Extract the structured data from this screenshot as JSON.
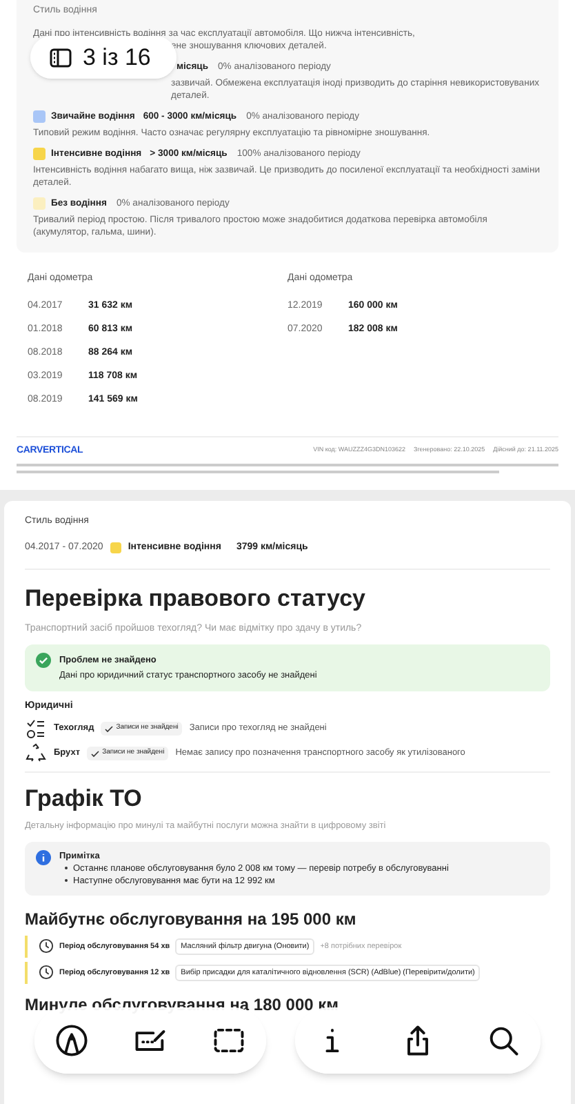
{
  "page_indicator": {
    "text": "3 із 16"
  },
  "driving_style": {
    "title": "Стиль водіння",
    "intro_line": "Дані про інтенсивність водіння за час експлуатації автомобіля. Що нижча інтенсивність,",
    "intro_rest": "ене зношування ключових деталей.",
    "levels": [
      {
        "kind": "covered",
        "label": "місяць",
        "share": "0% аналізованого періоду",
        "description": "зазвичай. Обмежена експлуатація іноді призводить до старіння невикористовуваних деталей."
      },
      {
        "kind": "filled",
        "color": "#a9c6f7",
        "label": "Звичайне водіння",
        "range": "600 - 3000 км/місяць",
        "share": "0% аналізованого періоду",
        "description": "Типовий режим водіння. Часто означає регулярну експлуатацію та рівномірне зношування."
      },
      {
        "kind": "filled",
        "color": "#f7d54a",
        "label": "Інтенсивне водіння",
        "range": "> 3000 км/місяць",
        "share": "100% аналізованого періоду",
        "description": "Інтенсивність водіння набагато вища, ніж зазвичай. Це призводить до посиленої експлуатації та необхідності заміни деталей."
      },
      {
        "kind": "outline",
        "color": "#fbefc0",
        "label": "Без водіння",
        "share": "0% аналізованого періоду",
        "description": "Тривалий період простою. Після тривалого простою може знадобитися додаткова перевірка автомобіля (акумулятор, гальма, шини)."
      }
    ]
  },
  "odometer": [
    {
      "title": "Дані одометра",
      "rows": [
        {
          "date": "04.2017",
          "km": "31 632 км"
        },
        {
          "date": "01.2018",
          "km": "60 813 км"
        },
        {
          "date": "08.2018",
          "km": "88 264 км"
        },
        {
          "date": "03.2019",
          "km": "118 708 км"
        },
        {
          "date": "08.2019",
          "km": "141 569 км"
        }
      ]
    },
    {
      "title": "Дані одометра",
      "rows": [
        {
          "date": "12.2019",
          "km": "160 000 км"
        },
        {
          "date": "07.2020",
          "km": "182 008 км"
        }
      ]
    }
  ],
  "footer": {
    "logo": "CARVERTICAL",
    "vin": "VIN код: WAUZZZ4G3DN103622",
    "generated": "Згенеровано: 22.10.2025",
    "valid": "Дійсний до: 21.11.2025"
  },
  "style_summary": {
    "title": "Стиль водіння",
    "period": "04.2017 - 07.2020",
    "color": "#f7d54a",
    "label": "Інтенсивне водіння",
    "value": "3799 км/місяць"
  },
  "legal": {
    "title": "Перевірка правового статусу",
    "subtitle": "Транспортний засіб пройшов техогляд? Чи має відмітку про здачу в утиль?",
    "alert": {
      "title": "Проблем не знайдено",
      "text": "Дані про юридичний статус транспортного засобу не знайдені"
    },
    "group": "Юридичні",
    "rows": [
      {
        "kind": "inspection",
        "label": "Техогляд",
        "badge": "Записи не знайдені",
        "text": "Записи про техогляд не знайдені"
      },
      {
        "kind": "scrap",
        "label": "Брухт",
        "badge": "Записи не знайдені",
        "text": "Немає запису про позначення транспортного засобу як утилізованого"
      }
    ]
  },
  "maintenance": {
    "title": "Графік ТО",
    "subtitle": "Детальну інформацію про минулі та майбутні послуги можна знайти в цифровому звіті",
    "note": {
      "title": "Примітка",
      "items": [
        "Останнє планове обслуговування було 2 008 км тому — перевір потребу в обслуговуванні",
        "Наступне обслуговування має бути на 12 992 км"
      ]
    },
    "future": {
      "title": "Майбутнє обслуговування на 195 000 км",
      "rows": [
        {
          "period": "Період обслуговування 54 хв",
          "task": "Масляний фільтр двигуна (Оновити)",
          "extra": "+8 потрібних перевірок"
        },
        {
          "period": "Період обслуговування 12 хв",
          "task": "Вибір присадки для каталітичного відновлення (SCR) (AdBlue) (Перевірити/долити)"
        }
      ]
    },
    "past": {
      "title": "Минуле обслуговування на 180 000 км"
    }
  }
}
